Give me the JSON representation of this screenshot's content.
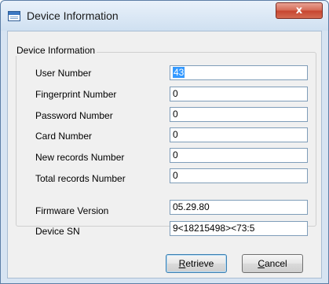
{
  "window": {
    "title": "Device Information",
    "close_glyph": "x",
    "icon": "app-window-icon"
  },
  "group": {
    "title": "Device Information"
  },
  "fields": [
    {
      "label": "User Number",
      "value": "43",
      "selected": true
    },
    {
      "label": "Fingerprint Number",
      "value": "0"
    },
    {
      "label": "Password Number",
      "value": "0"
    },
    {
      "label": "Card Number",
      "value": "0"
    },
    {
      "label": "New records Number",
      "value": "0"
    },
    {
      "label": "Total records Number",
      "value": "0"
    },
    {
      "label": "Firmware Version",
      "value": "05.29.80"
    },
    {
      "label": "Device SN",
      "value": "9<18215498><73:5"
    }
  ],
  "buttons": {
    "retrieve": {
      "accel": "R",
      "rest": "etrieve"
    },
    "cancel": {
      "accel": "C",
      "rest": "ancel"
    }
  },
  "colors": {
    "close_button": "#c74530",
    "selection": "#3399ff",
    "window_frame": "#d7e4f2"
  }
}
